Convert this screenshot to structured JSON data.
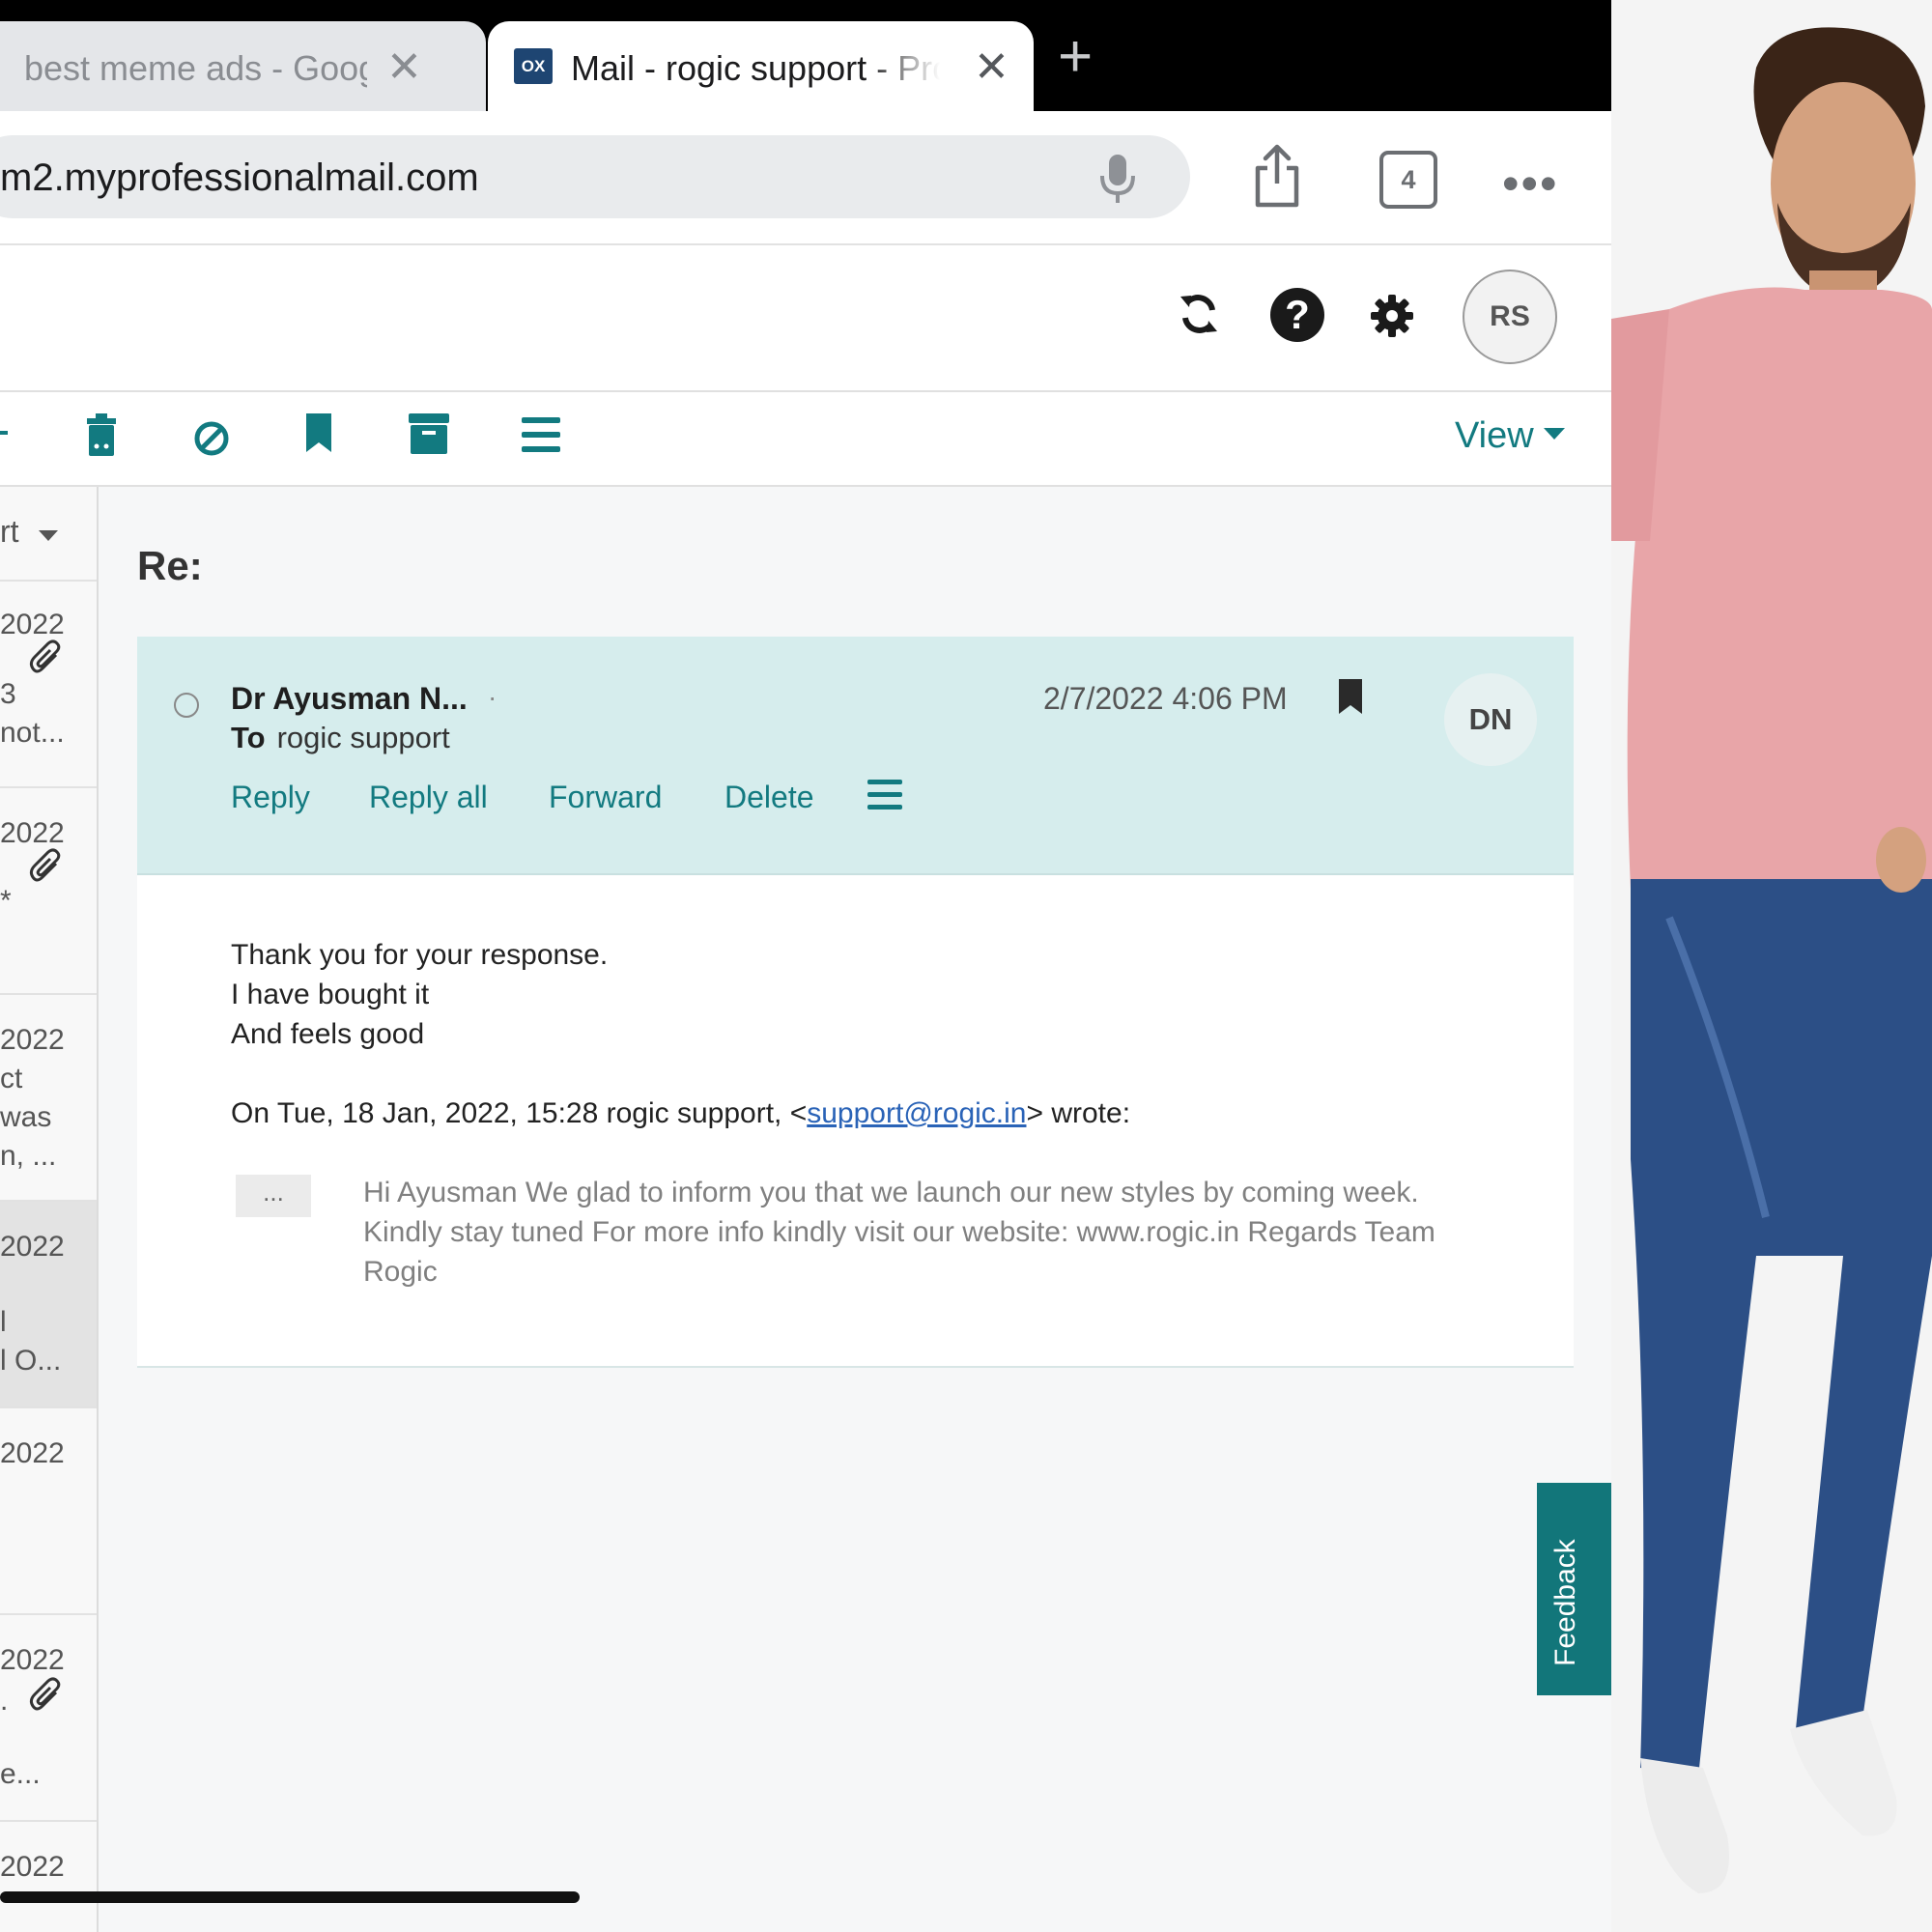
{
  "browser": {
    "tabs": [
      {
        "title": "best meme ads - Google",
        "active": false
      },
      {
        "title": "Mail - rogic support - Pro",
        "active": true,
        "favicon_text": "OX"
      }
    ],
    "url": "m2.myprofessionalmail.com",
    "tab_count": "4"
  },
  "app_header": {
    "user_initials": "RS"
  },
  "toolbar": {
    "view_label": "View"
  },
  "message_list": {
    "sort_label": "rt",
    "items": [
      {
        "lines": [
          "2022",
          "3",
          "not..."
        ],
        "has_attachment": true
      },
      {
        "lines": [
          "2022",
          "*"
        ],
        "has_attachment": true
      },
      {
        "lines": [
          "2022",
          "ct",
          "was",
          "n, ..."
        ],
        "has_attachment": false
      },
      {
        "lines": [
          "2022",
          "l",
          "l O..."
        ],
        "has_attachment": false,
        "selected": true
      },
      {
        "lines": [
          "2022"
        ],
        "has_attachment": false
      },
      {
        "lines": [
          "2022",
          ".",
          "e..."
        ],
        "has_attachment": true
      },
      {
        "lines": [
          "2022"
        ],
        "has_attachment": false
      }
    ]
  },
  "message": {
    "subject": "Re:",
    "sender": "Dr Ayusman N...",
    "to_label": "To",
    "to": "rogic support",
    "date": "2/7/2022 4:06 PM",
    "sender_initials": "DN",
    "actions": {
      "reply": "Reply",
      "reply_all": "Reply all",
      "forward": "Forward",
      "delete": "Delete"
    },
    "body_lines": [
      "Thank you for your response.",
      "I have bought it",
      "And feels good"
    ],
    "quote_header_prefix": "On Tue, 18 Jan, 2022, 15:28 rogic support, <",
    "quote_header_link": "support@rogic.in",
    "quote_header_suffix": "> wrote:",
    "quote_toggle": "...",
    "quoted_text": "Hi Ayusman We glad to inform you that we launch our new styles by coming week. Kindly stay tuned For more info kindly visit our website: www.rogic.in Regards Team Rogic"
  },
  "feedback_label": "Feedback",
  "colors": {
    "accent": "#127a80",
    "header_bg": "#d6eded"
  }
}
